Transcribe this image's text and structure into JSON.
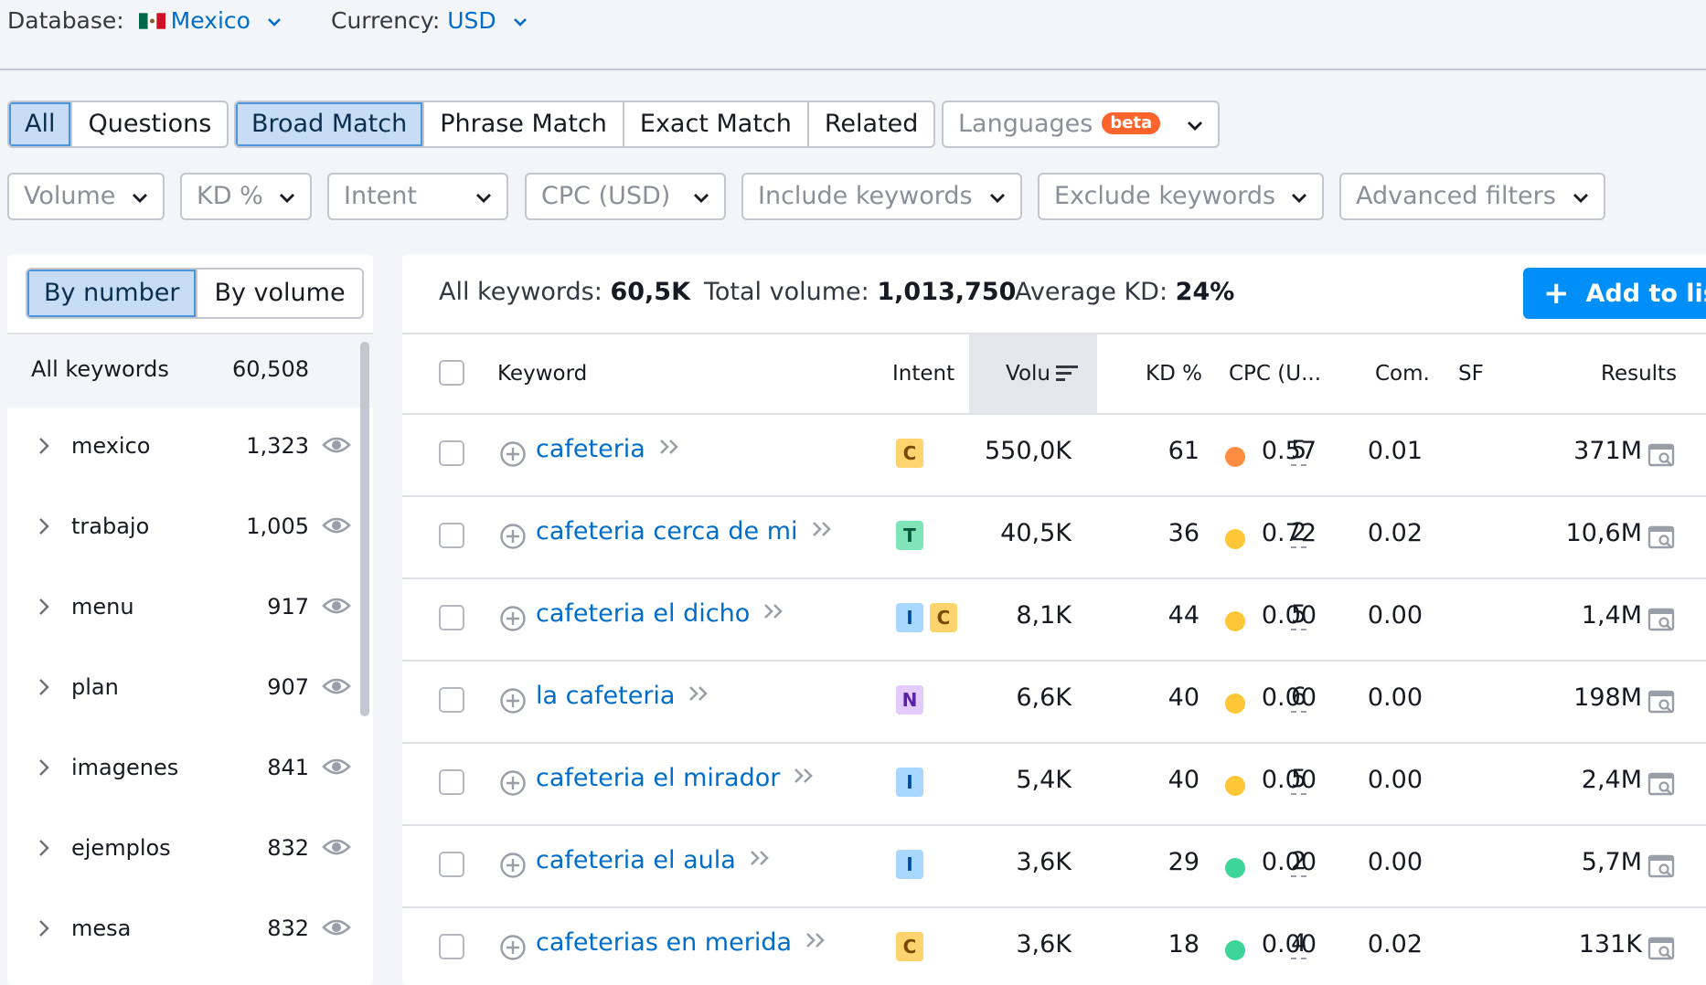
{
  "topbar": {
    "database_label": "Database:",
    "database_value": "Mexico",
    "currency_label": "Currency:",
    "currency_value": "USD"
  },
  "type_tabs": [
    "All",
    "Questions"
  ],
  "match_tabs": [
    "Broad Match",
    "Phrase Match",
    "Exact Match",
    "Related"
  ],
  "languages": {
    "label": "Languages",
    "badge": "beta"
  },
  "filters": [
    "Volume",
    "KD %",
    "Intent",
    "CPC (USD)",
    "Include keywords",
    "Exclude keywords",
    "Advanced filters"
  ],
  "left_panel": {
    "toggle": [
      "By number",
      "By volume"
    ],
    "all_label": "All keywords",
    "all_count": "60,508",
    "groups": [
      {
        "name": "mexico",
        "count": "1,323"
      },
      {
        "name": "trabajo",
        "count": "1,005"
      },
      {
        "name": "menu",
        "count": "917"
      },
      {
        "name": "plan",
        "count": "907"
      },
      {
        "name": "imagenes",
        "count": "841"
      },
      {
        "name": "ejemplos",
        "count": "832"
      },
      {
        "name": "mesa",
        "count": "832"
      }
    ]
  },
  "summary": {
    "all_label": "All keywords:",
    "all_value": "60,5K",
    "total_label": "Total volume:",
    "total_value": "1,013,750",
    "avg_label": "Average KD:",
    "avg_value": "24%",
    "add_button": "Add to list"
  },
  "columns": {
    "keyword": "Keyword",
    "intent": "Intent",
    "volume": "Volu",
    "kd": "KD %",
    "cpc": "CPC (U...",
    "com": "Com.",
    "sf": "SF",
    "results": "Results"
  },
  "colors": {
    "accent": "#006dca",
    "button": "#008ff8",
    "kd_orange": "#ff8c43",
    "kd_yellow": "#ffc738",
    "kd_green": "#3ed598"
  },
  "rows": [
    {
      "keyword": "cafeteria",
      "intent": [
        "C"
      ],
      "volume": "550,0K",
      "kd": "61",
      "kd_color": "#ff8c43",
      "cpc": "0.57",
      "com": "0.01",
      "sf": "5",
      "results": "371M"
    },
    {
      "keyword": "cafeteria cerca de mi",
      "intent": [
        "T"
      ],
      "volume": "40,5K",
      "kd": "36",
      "kd_color": "#ffc738",
      "cpc": "0.72",
      "com": "0.02",
      "sf": "2",
      "results": "10,6M"
    },
    {
      "keyword": "cafeteria el dicho",
      "intent": [
        "I",
        "C"
      ],
      "volume": "8,1K",
      "kd": "44",
      "kd_color": "#ffc738",
      "cpc": "0.00",
      "com": "0.00",
      "sf": "5",
      "results": "1,4M"
    },
    {
      "keyword": "la cafeteria",
      "intent": [
        "N"
      ],
      "volume": "6,6K",
      "kd": "40",
      "kd_color": "#ffc738",
      "cpc": "0.00",
      "com": "0.00",
      "sf": "6",
      "results": "198M"
    },
    {
      "keyword": "cafeteria el mirador",
      "intent": [
        "I"
      ],
      "volume": "5,4K",
      "kd": "40",
      "kd_color": "#ffc738",
      "cpc": "0.00",
      "com": "0.00",
      "sf": "5",
      "results": "2,4M"
    },
    {
      "keyword": "cafeteria el aula",
      "intent": [
        "I"
      ],
      "volume": "3,6K",
      "kd": "29",
      "kd_color": "#3ed598",
      "cpc": "0.00",
      "com": "0.00",
      "sf": "2",
      "results": "5,7M"
    },
    {
      "keyword": "cafeterias en merida",
      "intent": [
        "C"
      ],
      "volume": "3,6K",
      "kd": "18",
      "kd_color": "#3ed598",
      "cpc": "0.00",
      "com": "0.02",
      "sf": "4",
      "results": "131K"
    }
  ]
}
